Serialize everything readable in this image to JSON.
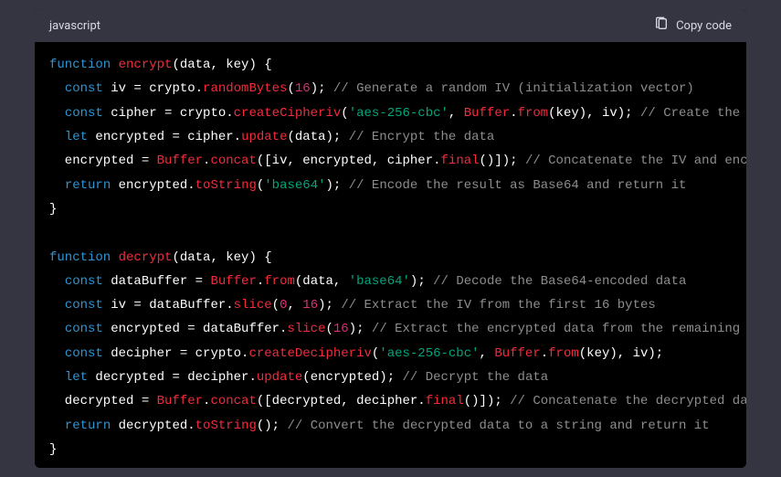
{
  "header": {
    "language_label": "javascript",
    "copy_label": "Copy code"
  },
  "code": {
    "lines": [
      [
        {
          "t": "function ",
          "c": "kw"
        },
        {
          "t": "encrypt",
          "c": "fn"
        },
        {
          "t": "(",
          "c": "punc"
        },
        {
          "t": "data, key",
          "c": "id"
        },
        {
          "t": ") {",
          "c": "punc"
        }
      ],
      [
        {
          "t": "  ",
          "c": "id"
        },
        {
          "t": "const",
          "c": "kw"
        },
        {
          "t": " iv = crypto.",
          "c": "id"
        },
        {
          "t": "randomBytes",
          "c": "fn"
        },
        {
          "t": "(",
          "c": "punc"
        },
        {
          "t": "16",
          "c": "num"
        },
        {
          "t": "); ",
          "c": "punc"
        },
        {
          "t": "// Generate a random IV (initialization vector)",
          "c": "cm"
        }
      ],
      [
        {
          "t": "  ",
          "c": "id"
        },
        {
          "t": "const",
          "c": "kw"
        },
        {
          "t": " cipher = crypto.",
          "c": "id"
        },
        {
          "t": "createCipheriv",
          "c": "fn"
        },
        {
          "t": "(",
          "c": "punc"
        },
        {
          "t": "'aes-256-cbc'",
          "c": "str"
        },
        {
          "t": ", ",
          "c": "punc"
        },
        {
          "t": "Buffer",
          "c": "cls"
        },
        {
          "t": ".",
          "c": "punc"
        },
        {
          "t": "from",
          "c": "fn"
        },
        {
          "t": "(key), iv); ",
          "c": "punc"
        },
        {
          "t": "// Create the cipher",
          "c": "cm"
        }
      ],
      [
        {
          "t": "  ",
          "c": "id"
        },
        {
          "t": "let",
          "c": "kw"
        },
        {
          "t": " encrypted = cipher.",
          "c": "id"
        },
        {
          "t": "update",
          "c": "fn"
        },
        {
          "t": "(data); ",
          "c": "punc"
        },
        {
          "t": "// Encrypt the data",
          "c": "cm"
        }
      ],
      [
        {
          "t": "  encrypted = ",
          "c": "id"
        },
        {
          "t": "Buffer",
          "c": "cls"
        },
        {
          "t": ".",
          "c": "punc"
        },
        {
          "t": "concat",
          "c": "fn"
        },
        {
          "t": "([iv, encrypted, cipher.",
          "c": "punc"
        },
        {
          "t": "final",
          "c": "fn"
        },
        {
          "t": "()]); ",
          "c": "punc"
        },
        {
          "t": "// Concatenate the IV and encrypted data",
          "c": "cm"
        }
      ],
      [
        {
          "t": "  ",
          "c": "id"
        },
        {
          "t": "return",
          "c": "kw"
        },
        {
          "t": " encrypted.",
          "c": "id"
        },
        {
          "t": "toString",
          "c": "fn"
        },
        {
          "t": "(",
          "c": "punc"
        },
        {
          "t": "'base64'",
          "c": "str"
        },
        {
          "t": "); ",
          "c": "punc"
        },
        {
          "t": "// Encode the result as Base64 and return it",
          "c": "cm"
        }
      ],
      [
        {
          "t": "}",
          "c": "punc"
        }
      ],
      [
        {
          "t": "",
          "c": "id"
        }
      ],
      [
        {
          "t": "function ",
          "c": "kw"
        },
        {
          "t": "decrypt",
          "c": "fn"
        },
        {
          "t": "(",
          "c": "punc"
        },
        {
          "t": "data, key",
          "c": "id"
        },
        {
          "t": ") {",
          "c": "punc"
        }
      ],
      [
        {
          "t": "  ",
          "c": "id"
        },
        {
          "t": "const",
          "c": "kw"
        },
        {
          "t": " dataBuffer = ",
          "c": "id"
        },
        {
          "t": "Buffer",
          "c": "cls"
        },
        {
          "t": ".",
          "c": "punc"
        },
        {
          "t": "from",
          "c": "fn"
        },
        {
          "t": "(data, ",
          "c": "punc"
        },
        {
          "t": "'base64'",
          "c": "str"
        },
        {
          "t": "); ",
          "c": "punc"
        },
        {
          "t": "// Decode the Base64-encoded data",
          "c": "cm"
        }
      ],
      [
        {
          "t": "  ",
          "c": "id"
        },
        {
          "t": "const",
          "c": "kw"
        },
        {
          "t": " iv = dataBuffer.",
          "c": "id"
        },
        {
          "t": "slice",
          "c": "fn"
        },
        {
          "t": "(",
          "c": "punc"
        },
        {
          "t": "0",
          "c": "num"
        },
        {
          "t": ", ",
          "c": "punc"
        },
        {
          "t": "16",
          "c": "num"
        },
        {
          "t": "); ",
          "c": "punc"
        },
        {
          "t": "// Extract the IV from the first 16 bytes",
          "c": "cm"
        }
      ],
      [
        {
          "t": "  ",
          "c": "id"
        },
        {
          "t": "const",
          "c": "kw"
        },
        {
          "t": " encrypted = dataBuffer.",
          "c": "id"
        },
        {
          "t": "slice",
          "c": "fn"
        },
        {
          "t": "(",
          "c": "punc"
        },
        {
          "t": "16",
          "c": "num"
        },
        {
          "t": "); ",
          "c": "punc"
        },
        {
          "t": "// Extract the encrypted data from the remaining bytes",
          "c": "cm"
        }
      ],
      [
        {
          "t": "  ",
          "c": "id"
        },
        {
          "t": "const",
          "c": "kw"
        },
        {
          "t": " decipher = crypto.",
          "c": "id"
        },
        {
          "t": "createDecipheriv",
          "c": "fn"
        },
        {
          "t": "(",
          "c": "punc"
        },
        {
          "t": "'aes-256-cbc'",
          "c": "str"
        },
        {
          "t": ", ",
          "c": "punc"
        },
        {
          "t": "Buffer",
          "c": "cls"
        },
        {
          "t": ".",
          "c": "punc"
        },
        {
          "t": "from",
          "c": "fn"
        },
        {
          "t": "(key), iv);",
          "c": "punc"
        }
      ],
      [
        {
          "t": "  ",
          "c": "id"
        },
        {
          "t": "let",
          "c": "kw"
        },
        {
          "t": " decrypted = decipher.",
          "c": "id"
        },
        {
          "t": "update",
          "c": "fn"
        },
        {
          "t": "(encrypted); ",
          "c": "punc"
        },
        {
          "t": "// Decrypt the data",
          "c": "cm"
        }
      ],
      [
        {
          "t": "  decrypted = ",
          "c": "id"
        },
        {
          "t": "Buffer",
          "c": "cls"
        },
        {
          "t": ".",
          "c": "punc"
        },
        {
          "t": "concat",
          "c": "fn"
        },
        {
          "t": "([decrypted, decipher.",
          "c": "punc"
        },
        {
          "t": "final",
          "c": "fn"
        },
        {
          "t": "()]); ",
          "c": "punc"
        },
        {
          "t": "// Concatenate the decrypted data",
          "c": "cm"
        }
      ],
      [
        {
          "t": "  ",
          "c": "id"
        },
        {
          "t": "return",
          "c": "kw"
        },
        {
          "t": " decrypted.",
          "c": "id"
        },
        {
          "t": "toString",
          "c": "fn"
        },
        {
          "t": "(); ",
          "c": "punc"
        },
        {
          "t": "// Convert the decrypted data to a string and return it",
          "c": "cm"
        }
      ],
      [
        {
          "t": "}",
          "c": "punc"
        }
      ]
    ]
  }
}
